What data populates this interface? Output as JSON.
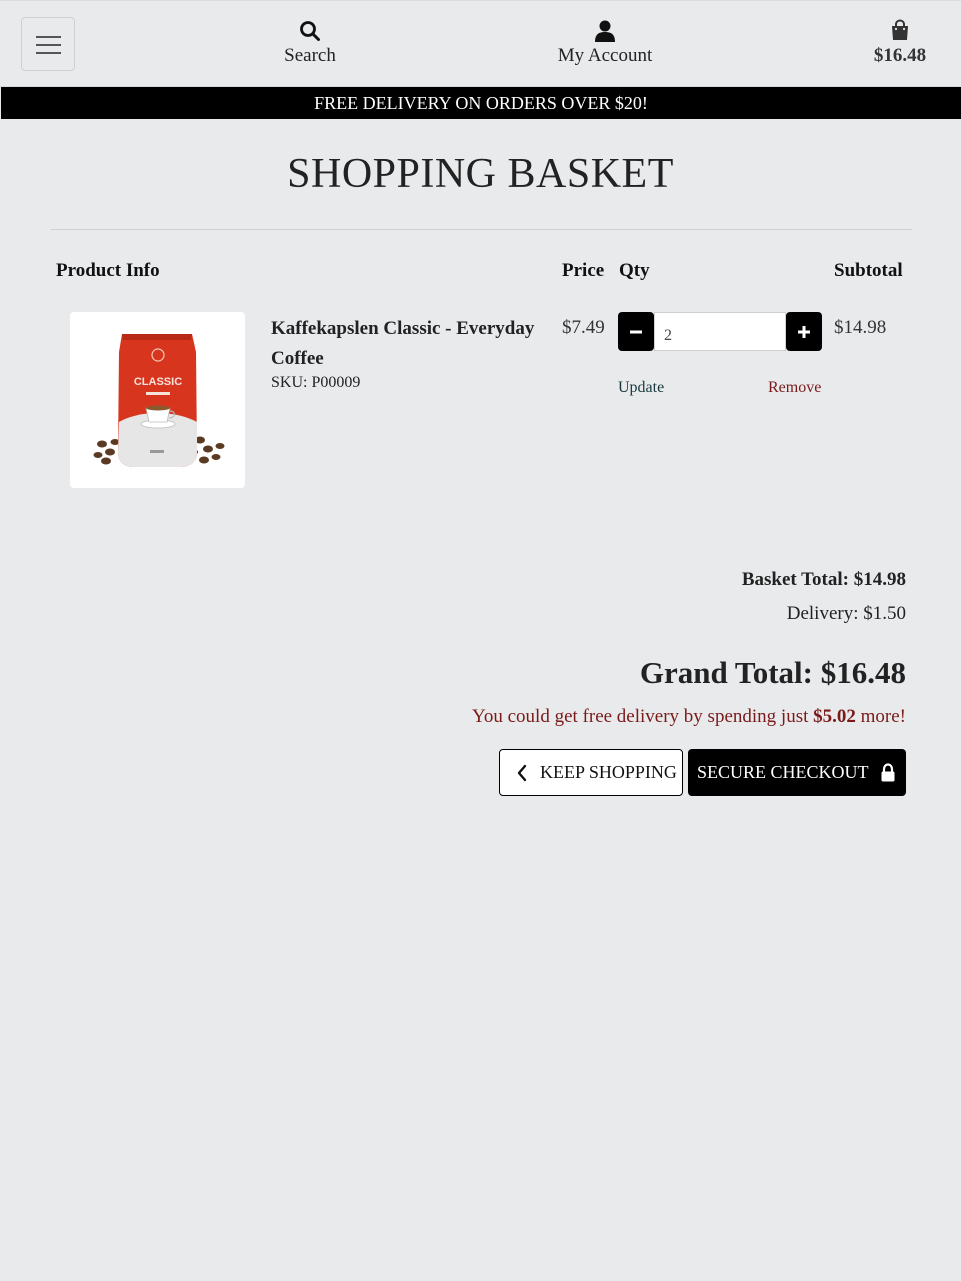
{
  "header": {
    "menu_icon": "hamburger-icon",
    "search_label": "Search",
    "account_label": "My Account",
    "basket_amount": "$16.48"
  },
  "promo_banner": "FREE DELIVERY ON ORDERS OVER $20!",
  "page_title": "SHOPPING BASKET",
  "table": {
    "headers": {
      "product": "Product Info",
      "price": "Price",
      "qty": "Qty",
      "subtotal": "Subtotal"
    },
    "items": [
      {
        "name": "Kaffekapslen Classic - Everyday Coffee",
        "sku": "SKU: P00009",
        "price": "$7.49",
        "qty": "2",
        "subtotal": "$14.98",
        "update_label": "Update",
        "remove_label": "Remove"
      }
    ]
  },
  "product_image_text": {
    "brand": "CLASSIC"
  },
  "totals": {
    "basket_total": "Basket Total: $14.98",
    "delivery": "Delivery: $1.50",
    "grand_total": "Grand Total: $16.48",
    "free_delivery_prefix": "You could get free delivery by spending just",
    "free_delivery_amount": "$5.02",
    "free_delivery_suffix": "more!"
  },
  "buttons": {
    "keep_shopping": "KEEP SHOPPING",
    "secure_checkout": "SECURE CHECKOUT"
  },
  "colors": {
    "background": "#e9eaec",
    "banner": "#000000",
    "remove_link": "#7a1a1a",
    "update_link": "#17393d",
    "product_bag": "#d8351e"
  }
}
